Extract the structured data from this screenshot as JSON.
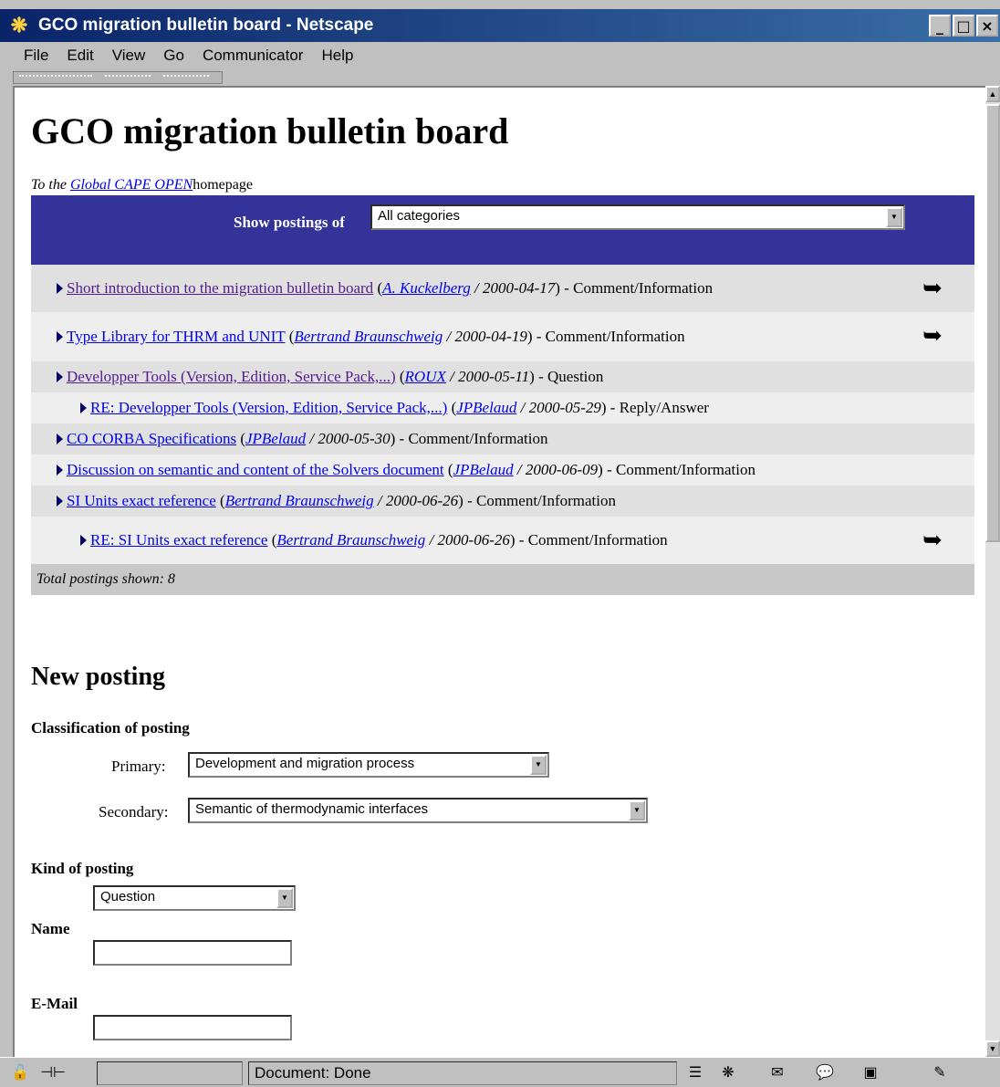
{
  "window": {
    "title": "GCO migration bulletin board - Netscape",
    "buttons": [
      "_",
      "□",
      "×"
    ]
  },
  "menu": [
    "File",
    "Edit",
    "View",
    "Go",
    "Communicator",
    "Help"
  ],
  "page": {
    "title": "GCO migration bulletin board",
    "intro_prefix": "To the",
    "intro_link": "Global CAPE OPEN",
    "intro_suffix": "homepage",
    "filter_label": "Show postings of",
    "filter_value": "All categories"
  },
  "postings": [
    {
      "title": "Short introduction to the migration bulletin board",
      "author": "A. Kuckelberg",
      "date": "2000-04-17",
      "kind": "Comment/Information",
      "reply": false,
      "has_icon": true
    },
    {
      "title": "Type Library for THRM and UNIT",
      "author": "Bertrand Braunschweig",
      "date": "2000-04-19",
      "kind": "Comment/Information",
      "reply": false,
      "has_icon": true
    },
    {
      "title": "Developper Tools (Version, Edition, Service Pack,...)",
      "author": "ROUX",
      "date": "2000-05-11",
      "kind": "Question",
      "reply": false,
      "has_icon": false
    },
    {
      "title": "RE: Developper Tools (Version, Edition, Service Pack,...)",
      "author": "JPBelaud",
      "date": "2000-05-29",
      "kind": "Reply/Answer",
      "reply": true,
      "has_icon": false
    },
    {
      "title": "CO CORBA Specifications",
      "author": "JPBelaud",
      "date": "2000-05-30",
      "kind": "Comment/Information",
      "reply": false,
      "has_icon": false
    },
    {
      "title": "Discussion on semantic and content of the Solvers document",
      "author": "JPBelaud",
      "date": "2000-06-09",
      "kind": "Comment/Information",
      "reply": false,
      "has_icon": false
    },
    {
      "title": "SI Units exact reference",
      "author": "Bertrand Braunschweig",
      "date": "2000-06-26",
      "kind": "Comment/Information",
      "reply": false,
      "has_icon": false
    },
    {
      "title": "RE: SI Units exact reference",
      "author": "Bertrand Braunschweig",
      "date": "2000-06-26",
      "kind": "Comment/Information",
      "reply": true,
      "has_icon": true
    }
  ],
  "total_label": "Total postings shown:",
  "total_count": "8",
  "form": {
    "heading": "New posting",
    "classification_label": "Classification of posting",
    "primary_label": "Primary:",
    "primary_value": "Development and migration process",
    "secondary_label": "Secondary:",
    "secondary_value": "Semantic of thermodynamic interfaces",
    "kind_label": "Kind of posting",
    "kind_value": "Question",
    "name_label": "Name",
    "email_label": "E-Mail"
  },
  "status": {
    "text": "Document: Done"
  }
}
